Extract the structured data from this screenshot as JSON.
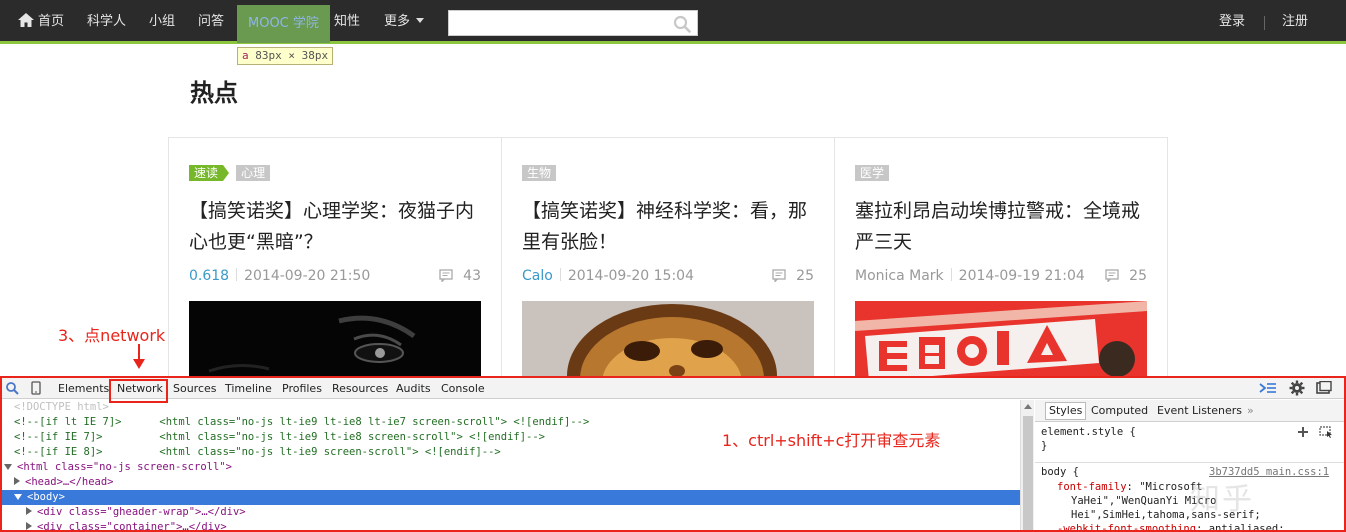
{
  "nav": {
    "home": "首页",
    "items": [
      "科学人",
      "小组",
      "问答",
      "MOOC 学院",
      "知性",
      "更多"
    ],
    "search_placeholder": "",
    "login": "登录",
    "register": "注册"
  },
  "size_tip": {
    "tag": "a",
    "w": "83",
    "h": "38",
    "unit": "px",
    "times": "×"
  },
  "section_title": "热点",
  "cards": [
    {
      "tags": [
        "速读",
        "心理"
      ],
      "title": "【搞笑诺奖】心理学奖：夜猫子内心也更“黑暗”？",
      "author": "0.618",
      "date": "2014-09-20 21:50",
      "comments": "43"
    },
    {
      "tags": [
        "生物"
      ],
      "title": "【搞笑诺奖】神经科学奖：看，那里有张脸！",
      "author": "Calo",
      "date": "2014-09-20 15:04",
      "comments": "25"
    },
    {
      "tags": [
        "医学"
      ],
      "title": "塞拉利昂启动埃博拉警戒：全境戒严三天",
      "author": "Monica Mark",
      "date": "2014-09-19 21:04",
      "comments": "25"
    }
  ],
  "annotations": {
    "step3": "3、点network",
    "step1": "1、ctrl+shift+c打开审查元素"
  },
  "devtools": {
    "tabs": [
      "Elements",
      "Network",
      "Sources",
      "Timeline",
      "Profiles",
      "Resources",
      "Audits",
      "Console"
    ],
    "code": [
      {
        "kind": "doctype",
        "text": "<!DOCTYPE html>"
      },
      {
        "kind": "comment",
        "text": "<!--[if lt IE 7]>      <html class=\"no-js lt-ie9 lt-ie8 lt-ie7 screen-scroll\"> <![endif]-->"
      },
      {
        "kind": "comment",
        "text": "<!--[if IE 7]>         <html class=\"no-js lt-ie9 lt-ie8 screen-scroll\"> <![endif]-->"
      },
      {
        "kind": "comment",
        "text": "<!--[if IE 8]>         <html class=\"no-js lt-ie9 screen-scroll\"> <![endif]-->"
      },
      {
        "kind": "tag",
        "text": "<html class=\"no-js screen-scroll\">"
      },
      {
        "kind": "tag",
        "text": "<head>…</head>"
      },
      {
        "kind": "tag",
        "text": "<body>"
      },
      {
        "kind": "tag",
        "text": "<div class=\"gheader-wrap\">…</div>"
      },
      {
        "kind": "tag",
        "text": "<div class=\"container\">…</div>"
      }
    ],
    "styles_tabs": [
      "Styles",
      "Computed",
      "Event Listeners",
      "»"
    ],
    "styles": {
      "element_style": "element.style {",
      "close_brace": "}",
      "body_selector": "body {",
      "source": "3b737dd5 main.css:1",
      "font_family_prop": "font-family",
      "font_family_val_1": ": \"Microsoft",
      "font_family_val_2": "YaHei\",\"WenQuanYi Micro",
      "font_family_val_3": "Hei\",SimHei,tahoma,sans-serif;",
      "smoothing_prop": "-webkit-font-smoothing",
      "smoothing_val": ": antialiased;"
    }
  },
  "watermark": "知乎"
}
